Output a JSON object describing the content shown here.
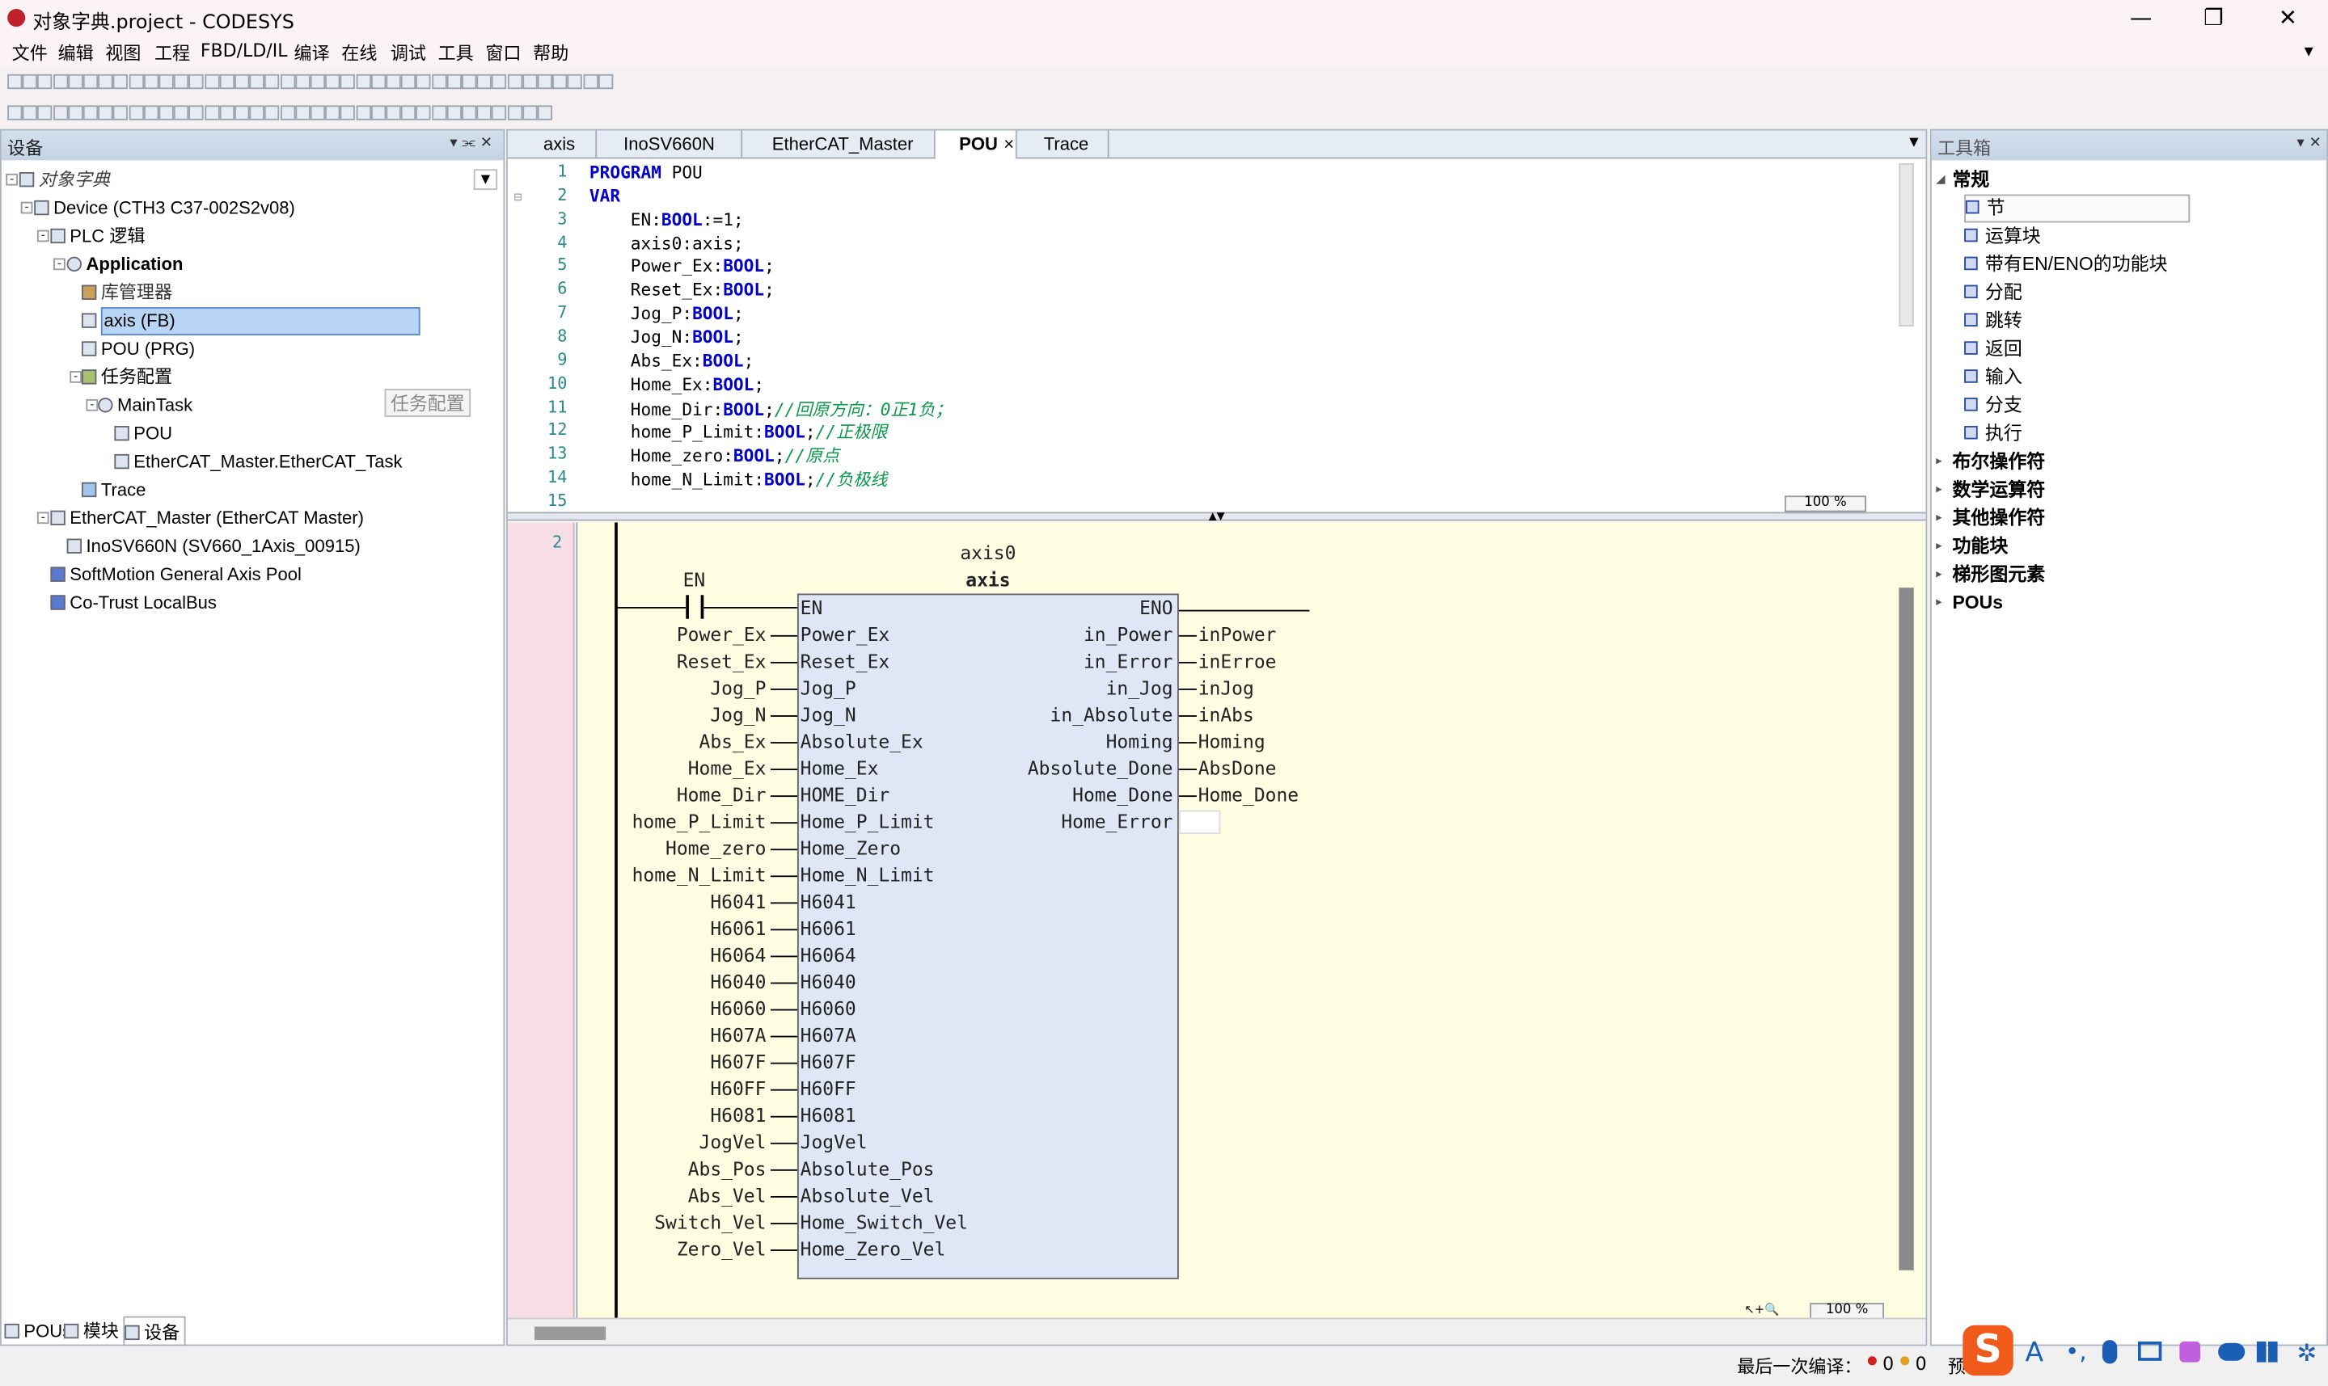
{
  "window": {
    "title": "对象字典.project - CODESYS",
    "minimize": "—",
    "restore": "❐",
    "close": "✕",
    "menu_arrow": "▾"
  },
  "menu": [
    "文件",
    "编辑",
    "视图",
    "工程",
    "FBD/LD/IL",
    "编译",
    "在线",
    "调试",
    "工具",
    "窗口",
    "帮助"
  ],
  "devices_panel": {
    "title": "设备",
    "header_buttons": "▾ ⫘ ✕",
    "tree": [
      {
        "label": "对象字典",
        "italic": true
      },
      {
        "label": "Device (CTH3 C37-002S2v08)"
      },
      {
        "label": "PLC 逻辑"
      },
      {
        "label": "Application",
        "bold": true
      },
      {
        "label": "库管理器"
      },
      {
        "label": "axis (FB)",
        "selected": true
      },
      {
        "label": "POU (PRG)"
      },
      {
        "label": "任务配置"
      },
      {
        "label": "MainTask"
      },
      {
        "label": "POU"
      },
      {
        "label": "EtherCAT_Master.EtherCAT_Task"
      },
      {
        "label": "Trace"
      },
      {
        "label": "EtherCAT_Master (EtherCAT Master)"
      },
      {
        "label": "InoSV660N (SV660_1Axis_00915)"
      },
      {
        "label": "SoftMotion General Axis Pool"
      },
      {
        "label": "Co-Trust LocalBus"
      }
    ],
    "tooltip": "任务配置",
    "bottom_tabs": [
      "POUs",
      "模块",
      "设备"
    ]
  },
  "editor": {
    "tabs": [
      {
        "label": "axis"
      },
      {
        "label": "InoSV660N"
      },
      {
        "label": "EtherCAT_Master"
      },
      {
        "label": "POU",
        "active": true,
        "close": "×"
      },
      {
        "label": "Trace"
      }
    ],
    "declaration": {
      "line_numbers": [
        "1",
        "2",
        "3",
        "4",
        "5",
        "6",
        "7",
        "8",
        "9",
        "10",
        "11",
        "12",
        "13",
        "14",
        "15"
      ],
      "lines": [
        [
          {
            "t": "PROGRAM",
            "k": "kw"
          },
          {
            "t": " POU",
            "k": ""
          }
        ],
        [
          {
            "t": "VAR",
            "k": "kw"
          }
        ],
        [
          {
            "t": "    EN:",
            "k": ""
          },
          {
            "t": "BOOL",
            "k": "kw"
          },
          {
            "t": ":=1;",
            "k": ""
          }
        ],
        [
          {
            "t": "    axis0:axis;",
            "k": ""
          }
        ],
        [
          {
            "t": "    Power_Ex:",
            "k": ""
          },
          {
            "t": "BOOL",
            "k": "kw"
          },
          {
            "t": ";",
            "k": ""
          }
        ],
        [
          {
            "t": "    Reset_Ex:",
            "k": ""
          },
          {
            "t": "BOOL",
            "k": "kw"
          },
          {
            "t": ";",
            "k": ""
          }
        ],
        [
          {
            "t": "    Jog_P:",
            "k": ""
          },
          {
            "t": "BOOL",
            "k": "kw"
          },
          {
            "t": ";",
            "k": ""
          }
        ],
        [
          {
            "t": "    Jog_N:",
            "k": ""
          },
          {
            "t": "BOOL",
            "k": "kw"
          },
          {
            "t": ";",
            "k": ""
          }
        ],
        [
          {
            "t": "    Abs_Ex:",
            "k": ""
          },
          {
            "t": "BOOL",
            "k": "kw"
          },
          {
            "t": ";",
            "k": ""
          }
        ],
        [
          {
            "t": "    Home_Ex:",
            "k": ""
          },
          {
            "t": "BOOL",
            "k": "kw"
          },
          {
            "t": ";",
            "k": ""
          }
        ],
        [
          {
            "t": "    Home_Dir:",
            "k": ""
          },
          {
            "t": "BOOL",
            "k": "kw"
          },
          {
            "t": ";",
            "k": ""
          },
          {
            "t": "//回原方向：0正1负；",
            "k": "cm"
          }
        ],
        [
          {
            "t": "    home_P_Limit:",
            "k": ""
          },
          {
            "t": "BOOL",
            "k": "kw"
          },
          {
            "t": ";",
            "k": ""
          },
          {
            "t": "//正极限",
            "k": "cm"
          }
        ],
        [
          {
            "t": "    Home_zero:",
            "k": ""
          },
          {
            "t": "BOOL",
            "k": "kw"
          },
          {
            "t": ";",
            "k": ""
          },
          {
            "t": "//原点",
            "k": "cm"
          }
        ],
        [
          {
            "t": "    home_N_Limit:",
            "k": ""
          },
          {
            "t": "BOOL",
            "k": "kw"
          },
          {
            "t": ";",
            "k": ""
          },
          {
            "t": "//负极线",
            "k": "cm"
          }
        ],
        []
      ],
      "zoom": "100 %"
    },
    "fbd": {
      "network_number": "2",
      "instance_name": "axis0",
      "block_type": "axis",
      "contact_label": "EN",
      "inputs": [
        {
          "var": "",
          "pin": "EN"
        },
        {
          "var": "Power_Ex",
          "pin": "Power_Ex"
        },
        {
          "var": "Reset_Ex",
          "pin": "Reset_Ex"
        },
        {
          "var": "Jog_P",
          "pin": "Jog_P"
        },
        {
          "var": "Jog_N",
          "pin": "Jog_N"
        },
        {
          "var": "Abs_Ex",
          "pin": "Absolute_Ex"
        },
        {
          "var": "Home_Ex",
          "pin": "Home_Ex"
        },
        {
          "var": "Home_Dir",
          "pin": "HOME_Dir"
        },
        {
          "var": "home_P_Limit",
          "pin": "Home_P_Limit"
        },
        {
          "var": "Home_zero",
          "pin": "Home_Zero"
        },
        {
          "var": "home_N_Limit",
          "pin": "Home_N_Limit"
        },
        {
          "var": "H6041",
          "pin": "H6041"
        },
        {
          "var": "H6061",
          "pin": "H6061"
        },
        {
          "var": "H6064",
          "pin": "H6064"
        },
        {
          "var": "H6040",
          "pin": "H6040"
        },
        {
          "var": "H6060",
          "pin": "H6060"
        },
        {
          "var": "H607A",
          "pin": "H607A"
        },
        {
          "var": "H607F",
          "pin": "H607F"
        },
        {
          "var": "H60FF",
          "pin": "H60FF"
        },
        {
          "var": "H6081",
          "pin": "H6081"
        },
        {
          "var": "JogVel",
          "pin": "JogVel"
        },
        {
          "var": "Abs_Pos",
          "pin": "Absolute_Pos"
        },
        {
          "var": "Abs_Vel",
          "pin": "Absolute_Vel"
        },
        {
          "var": "Switch_Vel",
          "pin": "Home_Switch_Vel"
        },
        {
          "var": "Zero_Vel",
          "pin": "Home_Zero_Vel"
        }
      ],
      "outputs": [
        {
          "pin": "ENO",
          "var": ""
        },
        {
          "pin": "in_Power",
          "var": "inPower"
        },
        {
          "pin": "in_Error",
          "var": "inErroe"
        },
        {
          "pin": "in_Jog",
          "var": "inJog"
        },
        {
          "pin": "in_Absolute",
          "var": "inAbs"
        },
        {
          "pin": "Homing",
          "var": "Homing"
        },
        {
          "pin": "Absolute_Done",
          "var": "AbsDone"
        },
        {
          "pin": "Home_Done",
          "var": "Home_Done"
        },
        {
          "pin": "Home_Error",
          "var": ""
        }
      ],
      "zoom": "100 %"
    }
  },
  "toolbox": {
    "title": "工具箱",
    "header_buttons": "▾ ✕",
    "groups": [
      {
        "label": "常规",
        "expanded": true,
        "items": [
          "节",
          "运算块",
          "带有EN/ENO的功能块",
          "分配",
          "跳转",
          "返回",
          "输入",
          "分支",
          "执行"
        ]
      },
      {
        "label": "布尔操作符"
      },
      {
        "label": "数学运算符"
      },
      {
        "label": "其他操作符"
      },
      {
        "label": "功能块"
      },
      {
        "label": "梯形图元素"
      },
      {
        "label": "POUs"
      }
    ]
  },
  "status": {
    "last_compile_label": "最后一次编译：",
    "errors": "0",
    "warnings": "0",
    "precompile": "预"
  },
  "colors": {
    "accent": "#1a5fb4",
    "selection": "#b8d5f5",
    "fbd_bg": "#fdfde2",
    "block_fill": "#dfe7f7",
    "gutter": "#f7dde5",
    "keyword": "#0000c8",
    "comment": "#0a9a4a"
  }
}
